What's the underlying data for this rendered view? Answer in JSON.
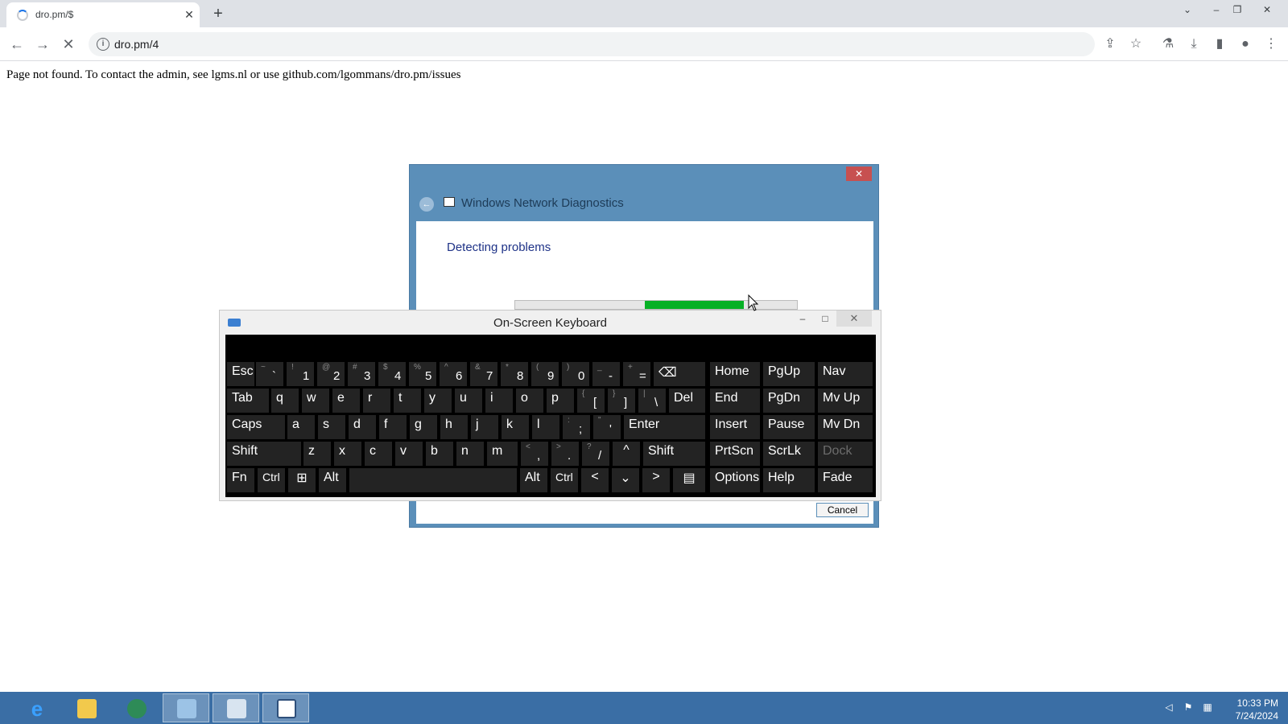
{
  "browser": {
    "tab": {
      "title": "dro.pm/$",
      "close_glyph": "✕"
    },
    "new_tab_glyph": "+",
    "window_controls": {
      "dropdown": "⌄",
      "minimize": "–",
      "restore": "❐",
      "close": "✕"
    },
    "address": "dro.pm/4",
    "icons": [
      "back-icon",
      "forward-icon",
      "stop-icon",
      "info-icon",
      "share-icon",
      "star-icon",
      "labs-icon",
      "download-icon",
      "sidepanel-icon",
      "profile-icon",
      "menu-icon"
    ]
  },
  "page": {
    "message": "Page not found. To contact the admin, see lgms.nl or use github.com/lgommans/dro.pm/issues"
  },
  "diagnostics": {
    "title": "Windows Network Diagnostics",
    "heading": "Detecting problems",
    "progress": 0.35,
    "cancel_label": "Cancel",
    "close_glyph": "✕"
  },
  "osk": {
    "title": "On-Screen Keyboard",
    "minimize": "–",
    "maximize": "□",
    "close": "✕",
    "keys": {
      "esc": "Esc",
      "tilde": "`",
      "tilde_shift": "~",
      "n1": "1",
      "n1s": "!",
      "n2": "2",
      "n2s": "@",
      "n3": "3",
      "n3s": "#",
      "n4": "4",
      "n4s": "$",
      "n5": "5",
      "n5s": "%",
      "n6": "6",
      "n6s": "^",
      "n7": "7",
      "n7s": "&",
      "n8": "8",
      "n8s": "*",
      "n9": "9",
      "n9s": "(",
      "n0": "0",
      "n0s": ")",
      "minus": "-",
      "minus_shift": "_",
      "equals": "=",
      "equals_shift": "+",
      "backspace": "⌫",
      "home": "Home",
      "pgup": "PgUp",
      "nav": "Nav",
      "tab": "Tab",
      "q": "q",
      "w": "w",
      "e": "e",
      "r": "r",
      "t": "t",
      "y": "y",
      "u": "u",
      "i": "i",
      "o": "o",
      "p": "p",
      "lbracket": "[",
      "lbracket_shift": "{",
      "rbracket": "]",
      "rbracket_shift": "}",
      "backslash": "\\",
      "backslash_shift": "|",
      "del": "Del",
      "end": "End",
      "pgdn": "PgDn",
      "mvup": "Mv Up",
      "caps": "Caps",
      "a": "a",
      "s": "s",
      "d": "d",
      "f": "f",
      "g": "g",
      "h": "h",
      "j": "j",
      "k": "k",
      "l": "l",
      "semicolon": ";",
      "semicolon_shift": ":",
      "quote": "'",
      "quote_shift": "\"",
      "enter": "Enter",
      "insert": "Insert",
      "pause": "Pause",
      "mvdn": "Mv Dn",
      "shift": "Shift",
      "z": "z",
      "x": "x",
      "c": "c",
      "v": "v",
      "b": "b",
      "n": "n",
      "m": "m",
      "comma": ",",
      "comma_shift": "<",
      "period": ".",
      "period_shift": ">",
      "slash": "/",
      "slash_shift": "?",
      "up": "^",
      "shift_r": "Shift",
      "prtscn": "PrtScn",
      "scrlk": "ScrLk",
      "dock": "Dock",
      "fn": "Fn",
      "ctrl": "Ctrl",
      "win": "⊞",
      "alt": "Alt",
      "alt_r": "Alt",
      "ctrl_r": "Ctrl",
      "left": "<",
      "down": "⌄",
      "right": ">",
      "menu": "▤",
      "options": "Options",
      "help": "Help",
      "fade": "Fade"
    }
  },
  "taskbar": {
    "apps": [
      "internet-explorer",
      "file-explorer",
      "network-globe",
      "control-panel",
      "remote-desktop",
      "network-diagnostics"
    ],
    "clock_time": "10:33 PM",
    "clock_date": "7/24/2024",
    "tray": [
      "volume-muted-icon",
      "action-center-flag-icon",
      "network-icon"
    ]
  },
  "colors": {
    "accent_green": "#06b025",
    "dialog_frame": "#5b8fb9",
    "taskbar": "#3a6ea5",
    "close_red": "#c75050"
  }
}
